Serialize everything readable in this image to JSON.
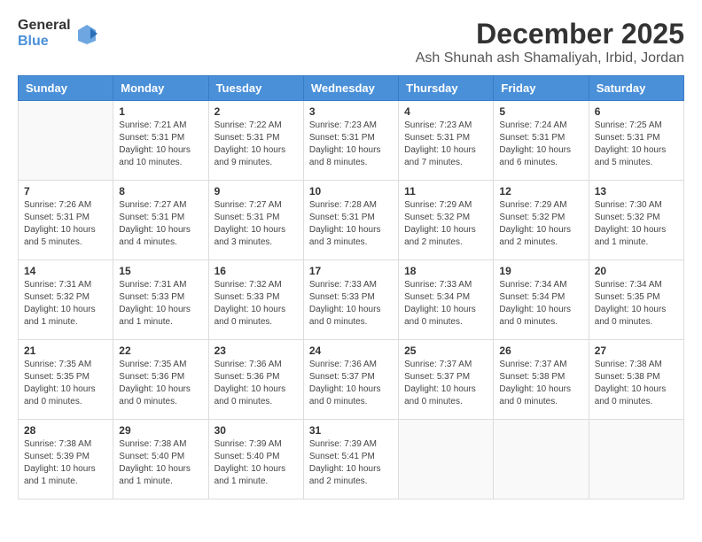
{
  "logo": {
    "general": "General",
    "blue": "Blue"
  },
  "title": "December 2025",
  "subtitle": "Ash Shunah ash Shamaliyah, Irbid, Jordan",
  "days": [
    "Sunday",
    "Monday",
    "Tuesday",
    "Wednesday",
    "Thursday",
    "Friday",
    "Saturday"
  ],
  "weeks": [
    [
      {
        "day": "",
        "content": ""
      },
      {
        "day": "1",
        "content": "Sunrise: 7:21 AM\nSunset: 5:31 PM\nDaylight: 10 hours\nand 10 minutes."
      },
      {
        "day": "2",
        "content": "Sunrise: 7:22 AM\nSunset: 5:31 PM\nDaylight: 10 hours\nand 9 minutes."
      },
      {
        "day": "3",
        "content": "Sunrise: 7:23 AM\nSunset: 5:31 PM\nDaylight: 10 hours\nand 8 minutes."
      },
      {
        "day": "4",
        "content": "Sunrise: 7:23 AM\nSunset: 5:31 PM\nDaylight: 10 hours\nand 7 minutes."
      },
      {
        "day": "5",
        "content": "Sunrise: 7:24 AM\nSunset: 5:31 PM\nDaylight: 10 hours\nand 6 minutes."
      },
      {
        "day": "6",
        "content": "Sunrise: 7:25 AM\nSunset: 5:31 PM\nDaylight: 10 hours\nand 5 minutes."
      }
    ],
    [
      {
        "day": "7",
        "content": "Sunrise: 7:26 AM\nSunset: 5:31 PM\nDaylight: 10 hours\nand 5 minutes."
      },
      {
        "day": "8",
        "content": "Sunrise: 7:27 AM\nSunset: 5:31 PM\nDaylight: 10 hours\nand 4 minutes."
      },
      {
        "day": "9",
        "content": "Sunrise: 7:27 AM\nSunset: 5:31 PM\nDaylight: 10 hours\nand 3 minutes."
      },
      {
        "day": "10",
        "content": "Sunrise: 7:28 AM\nSunset: 5:31 PM\nDaylight: 10 hours\nand 3 minutes."
      },
      {
        "day": "11",
        "content": "Sunrise: 7:29 AM\nSunset: 5:32 PM\nDaylight: 10 hours\nand 2 minutes."
      },
      {
        "day": "12",
        "content": "Sunrise: 7:29 AM\nSunset: 5:32 PM\nDaylight: 10 hours\nand 2 minutes."
      },
      {
        "day": "13",
        "content": "Sunrise: 7:30 AM\nSunset: 5:32 PM\nDaylight: 10 hours\nand 1 minute."
      }
    ],
    [
      {
        "day": "14",
        "content": "Sunrise: 7:31 AM\nSunset: 5:32 PM\nDaylight: 10 hours\nand 1 minute."
      },
      {
        "day": "15",
        "content": "Sunrise: 7:31 AM\nSunset: 5:33 PM\nDaylight: 10 hours\nand 1 minute."
      },
      {
        "day": "16",
        "content": "Sunrise: 7:32 AM\nSunset: 5:33 PM\nDaylight: 10 hours\nand 0 minutes."
      },
      {
        "day": "17",
        "content": "Sunrise: 7:33 AM\nSunset: 5:33 PM\nDaylight: 10 hours\nand 0 minutes."
      },
      {
        "day": "18",
        "content": "Sunrise: 7:33 AM\nSunset: 5:34 PM\nDaylight: 10 hours\nand 0 minutes."
      },
      {
        "day": "19",
        "content": "Sunrise: 7:34 AM\nSunset: 5:34 PM\nDaylight: 10 hours\nand 0 minutes."
      },
      {
        "day": "20",
        "content": "Sunrise: 7:34 AM\nSunset: 5:35 PM\nDaylight: 10 hours\nand 0 minutes."
      }
    ],
    [
      {
        "day": "21",
        "content": "Sunrise: 7:35 AM\nSunset: 5:35 PM\nDaylight: 10 hours\nand 0 minutes."
      },
      {
        "day": "22",
        "content": "Sunrise: 7:35 AM\nSunset: 5:36 PM\nDaylight: 10 hours\nand 0 minutes."
      },
      {
        "day": "23",
        "content": "Sunrise: 7:36 AM\nSunset: 5:36 PM\nDaylight: 10 hours\nand 0 minutes."
      },
      {
        "day": "24",
        "content": "Sunrise: 7:36 AM\nSunset: 5:37 PM\nDaylight: 10 hours\nand 0 minutes."
      },
      {
        "day": "25",
        "content": "Sunrise: 7:37 AM\nSunset: 5:37 PM\nDaylight: 10 hours\nand 0 minutes."
      },
      {
        "day": "26",
        "content": "Sunrise: 7:37 AM\nSunset: 5:38 PM\nDaylight: 10 hours\nand 0 minutes."
      },
      {
        "day": "27",
        "content": "Sunrise: 7:38 AM\nSunset: 5:38 PM\nDaylight: 10 hours\nand 0 minutes."
      }
    ],
    [
      {
        "day": "28",
        "content": "Sunrise: 7:38 AM\nSunset: 5:39 PM\nDaylight: 10 hours\nand 1 minute."
      },
      {
        "day": "29",
        "content": "Sunrise: 7:38 AM\nSunset: 5:40 PM\nDaylight: 10 hours\nand 1 minute."
      },
      {
        "day": "30",
        "content": "Sunrise: 7:39 AM\nSunset: 5:40 PM\nDaylight: 10 hours\nand 1 minute."
      },
      {
        "day": "31",
        "content": "Sunrise: 7:39 AM\nSunset: 5:41 PM\nDaylight: 10 hours\nand 2 minutes."
      },
      {
        "day": "",
        "content": ""
      },
      {
        "day": "",
        "content": ""
      },
      {
        "day": "",
        "content": ""
      }
    ]
  ]
}
